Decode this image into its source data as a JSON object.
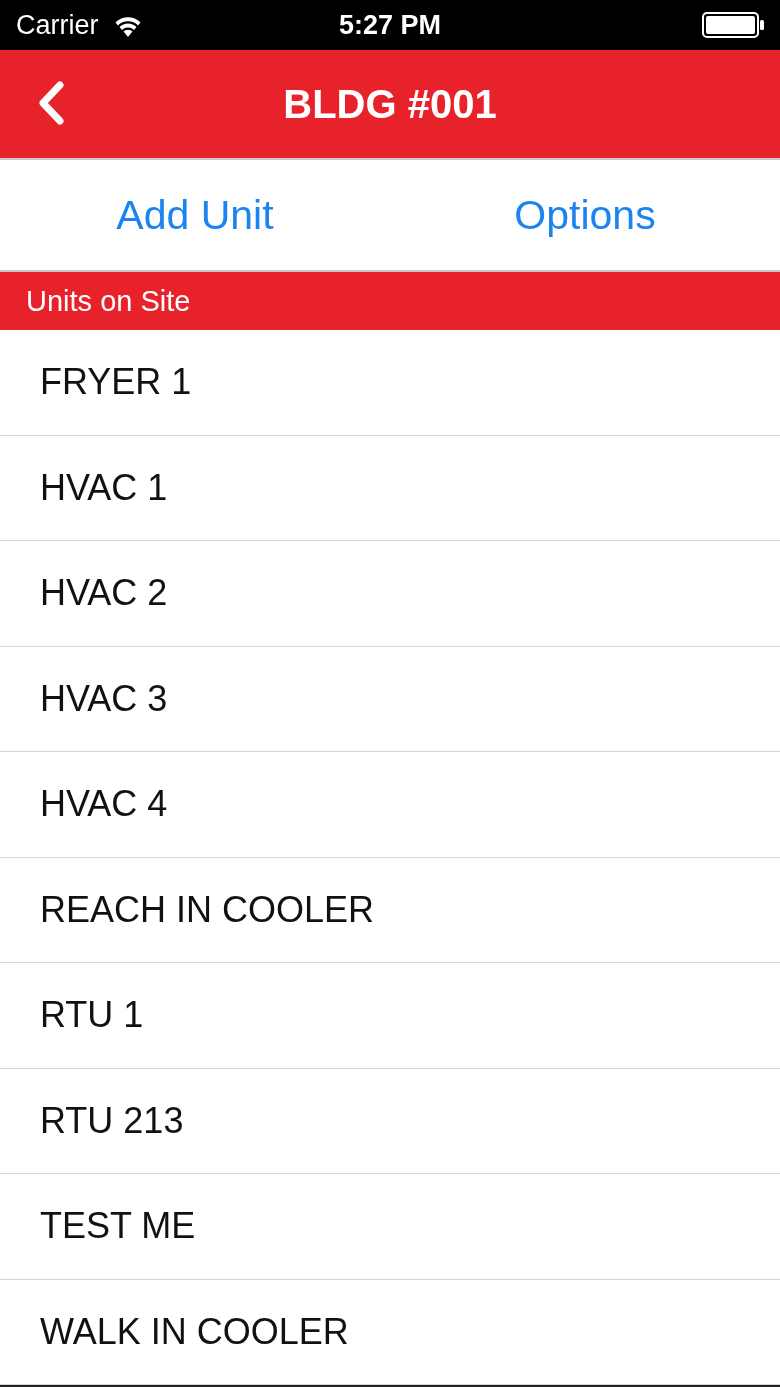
{
  "status_bar": {
    "carrier": "Carrier",
    "time": "5:27 PM"
  },
  "nav_bar": {
    "title": "BLDG #001"
  },
  "actions": [
    "Add Unit",
    "Options"
  ],
  "section": {
    "title": "Units on Site"
  },
  "units": [
    "FRYER 1",
    "HVAC 1",
    "HVAC 2",
    "HVAC 3",
    "HVAC 4",
    "REACH IN COOLER",
    "RTU 1",
    "RTU 213",
    "TEST ME",
    "WALK IN COOLER"
  ]
}
